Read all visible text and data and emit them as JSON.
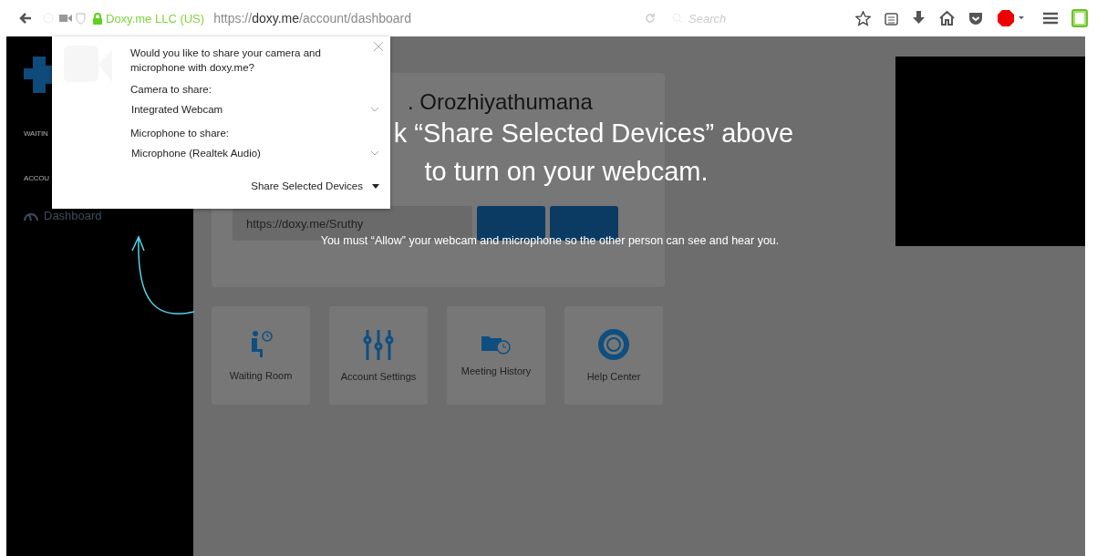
{
  "browser": {
    "identity": "Doxy.me LLC (US)",
    "url": {
      "scheme": "https://",
      "host": "doxy.me",
      "path": "/account/dashboard"
    },
    "search": {
      "placeholder": "Search"
    }
  },
  "sidebar": {
    "sections": [
      {
        "label": "WAITIN"
      },
      {
        "label": "ACCOU"
      }
    ],
    "items": [
      {
        "label": "Dashboard"
      }
    ]
  },
  "dashboard": {
    "title": ". Orozhiyathumana",
    "room_url": "https://doxy.me/Sruthy",
    "tiles": [
      {
        "kind": "waiting",
        "label": "Waiting Room"
      },
      {
        "kind": "settings",
        "label": "Account Settings"
      },
      {
        "kind": "history",
        "label": "Meeting History"
      },
      {
        "kind": "help",
        "label": "Help Center"
      }
    ]
  },
  "permission_popup": {
    "question": "Would you like to share your camera and microphone with doxy.me?",
    "camera_label": "Camera to share:",
    "camera": "Integrated Webcam",
    "microphone_label": "Microphone to share:",
    "microphone": "Microphone (Realtek Audio)",
    "share_button": "Share Selected Devices"
  },
  "overlay": {
    "headline": [
      "k “Share Selected Devices” above",
      "to turn on your webcam."
    ],
    "note": "You must “Allow” your webcam and microphone so the other person can see and hear you."
  }
}
